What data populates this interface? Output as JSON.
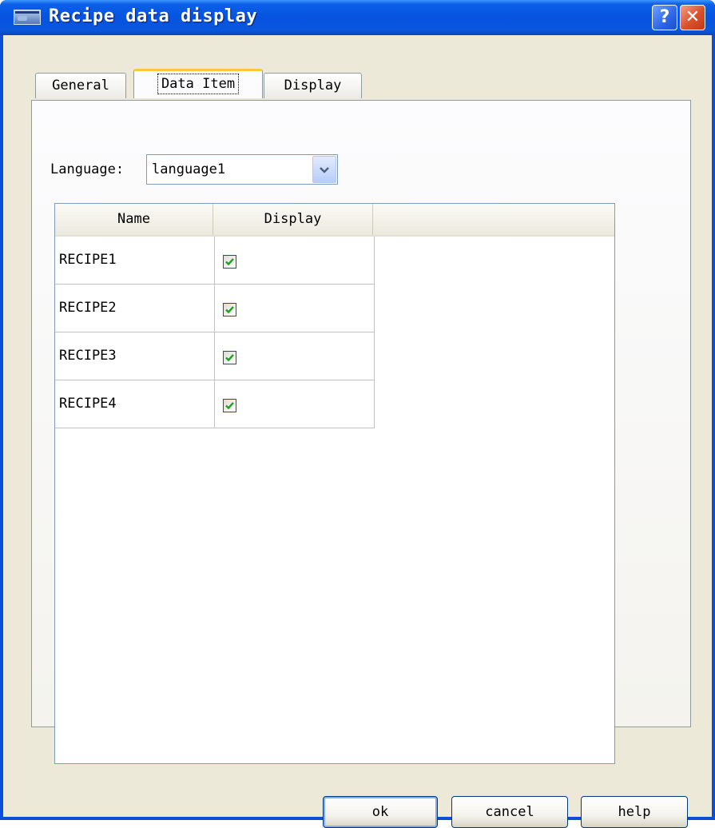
{
  "window": {
    "title": "Recipe data display"
  },
  "tabs": [
    {
      "label": "General",
      "active": false
    },
    {
      "label": "Data Item",
      "active": true
    },
    {
      "label": "Display",
      "active": false
    }
  ],
  "language": {
    "label": "Language:",
    "value": "language1"
  },
  "table": {
    "columns": [
      "Name",
      "Display"
    ],
    "rows": [
      {
        "name": "RECIPE1",
        "display": true
      },
      {
        "name": "RECIPE2",
        "display": true
      },
      {
        "name": "RECIPE3",
        "display": true
      },
      {
        "name": "RECIPE4",
        "display": true
      }
    ]
  },
  "buttons": {
    "ok": "ok",
    "cancel": "cancel",
    "help": "help"
  },
  "colors": {
    "titlebar": "#0553e0",
    "checkmark": "#21a121",
    "tab_highlight": "#ffc83c"
  }
}
